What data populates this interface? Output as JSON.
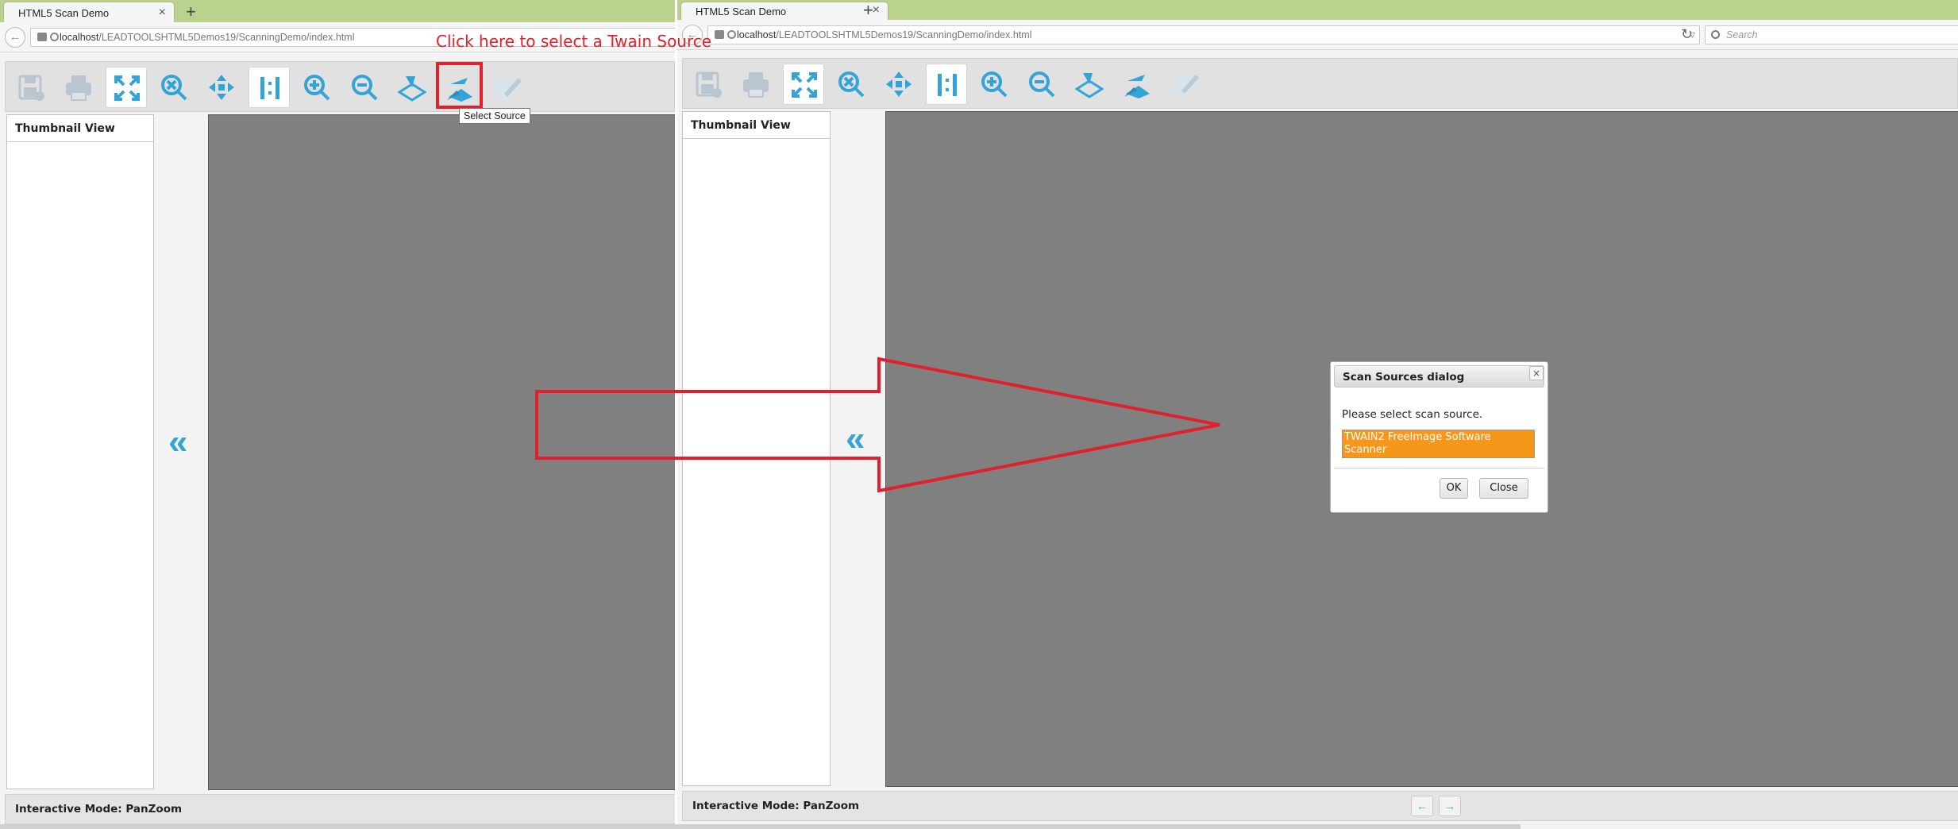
{
  "left": {
    "tab_title": "HTML5 Scan Demo",
    "url_host": "localhost",
    "url_path": "/LEADTOOLSHTML5Demos19/ScanningDemo/index.html",
    "thumbnail_header": "Thumbnail View",
    "status": "Interactive Mode: PanZoom",
    "tooltip": "Select Source",
    "callout": "Click here to select a Twain Source"
  },
  "right": {
    "tab_title": "HTML5 Scan Demo",
    "url_host": "localhost",
    "url_path": "/LEADTOOLSHTML5Demos19/ScanningDemo/index.html",
    "search_placeholder": "Search",
    "thumbnail_header": "Thumbnail View",
    "status": "Interactive Mode: PanZoom"
  },
  "dialog": {
    "title": "Scan Sources dialog",
    "prompt": "Please select scan source.",
    "sources": [
      "TWAIN2 FreeImage Software Scanner"
    ],
    "ok_label": "OK",
    "close_label": "Close"
  },
  "toolbar_icons": [
    "save-icon",
    "print-icon",
    "fit-page-icon",
    "fit-width-icon",
    "fit-all-icon",
    "actual-size-icon",
    "zoom-in-icon",
    "zoom-out-icon",
    "acquire-icon",
    "select-source-icon",
    "edit-icon"
  ],
  "colors": {
    "accent": "#34a4d6",
    "highlight": "#e0202c",
    "selected_source": "#f5971a",
    "tabbar": "#b9d28d",
    "viewer_bg": "#808080"
  },
  "glyphs": {
    "tab_close": "×",
    "new_tab": "+",
    "collapse": "«",
    "back": "←",
    "prev": "←",
    "next": "→",
    "reload": "↻",
    "dropdown": "▿",
    "dialog_close": "×"
  }
}
